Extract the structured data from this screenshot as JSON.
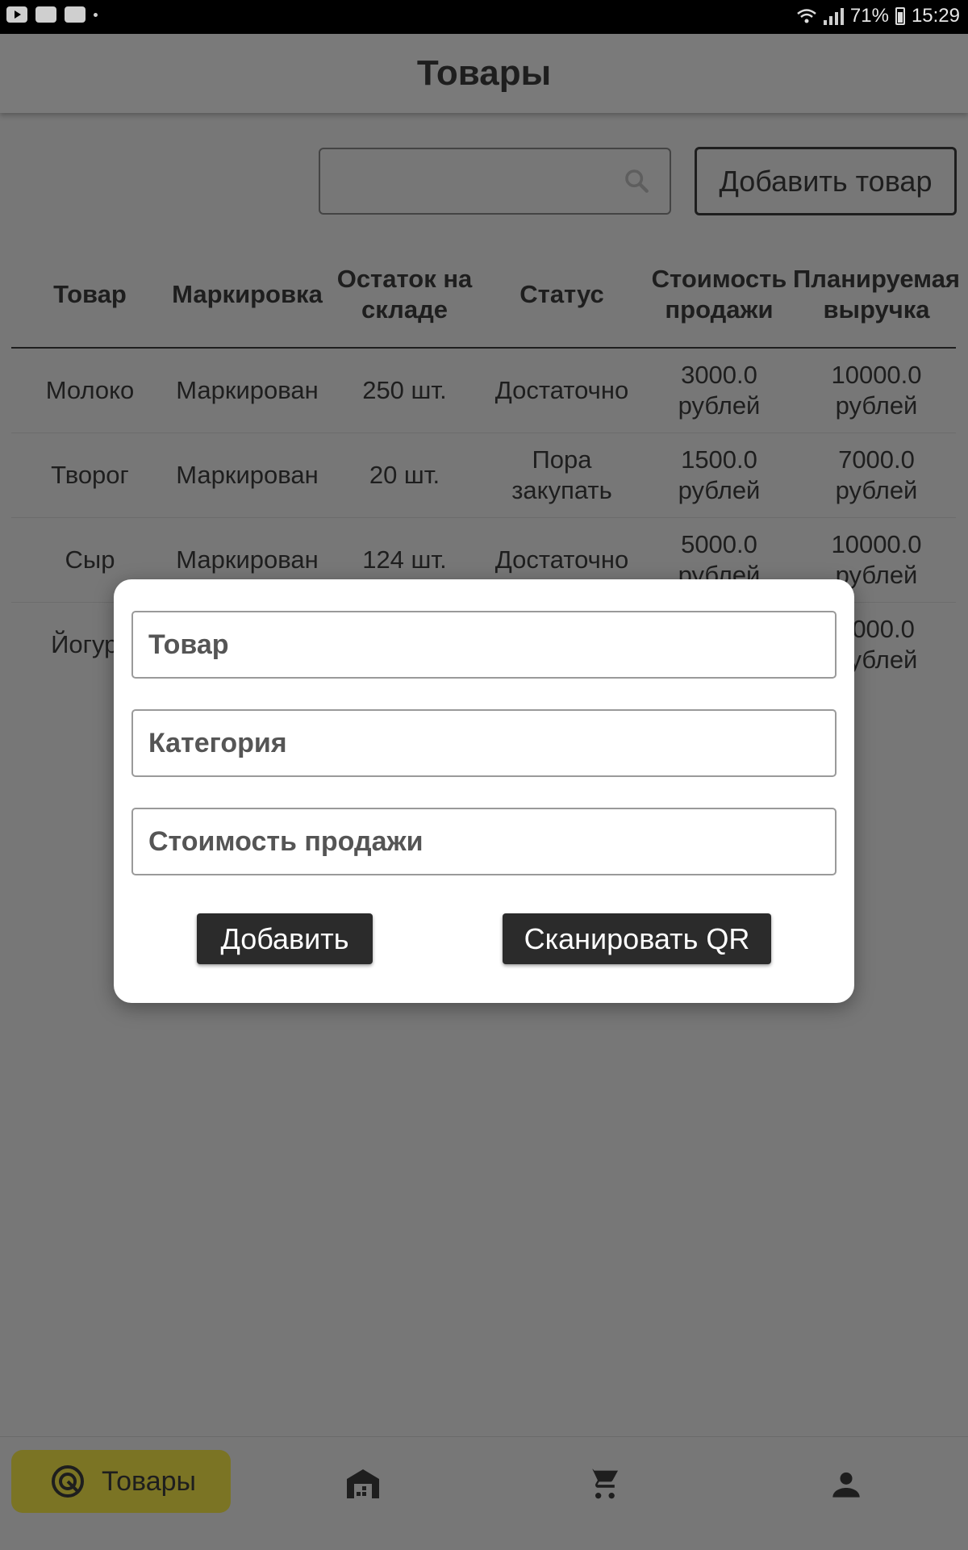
{
  "status_bar": {
    "battery": "71%",
    "time": "15:29"
  },
  "app_bar": {
    "title": "Товары"
  },
  "toolbar": {
    "search_placeholder": "",
    "add_button_label": "Добавить товар"
  },
  "table": {
    "headers": [
      "Товар",
      "Маркировка",
      "Остаток на складе",
      "Статус",
      "Стоимость продажи",
      "Планируемая выручка"
    ],
    "rows": [
      [
        "Молоко",
        "Маркирован",
        "250 шт.",
        "Достаточно",
        "3000.0 рублей",
        "10000.0 рублей"
      ],
      [
        "Творог",
        "Маркирован",
        "20 шт.",
        "Пора закупать",
        "1500.0 рублей",
        "7000.0 рублей"
      ],
      [
        "Сыр",
        "Маркирован",
        "124 шт.",
        "Достаточно",
        "5000.0 рублей",
        "10000.0 рублей"
      ],
      [
        "Йогурт",
        "",
        "",
        "",
        "",
        "5000.0 рублей"
      ]
    ]
  },
  "dialog": {
    "product_placeholder": "Товар",
    "category_placeholder": "Категория",
    "price_placeholder": "Стоимость продажи",
    "add_label": "Добавить",
    "scan_label": "Сканировать QR"
  },
  "bottom_nav": {
    "active_label": "Товары",
    "items": [
      "target-icon",
      "warehouse-icon",
      "cart-icon",
      "person-icon"
    ],
    "active_color": "#7b7424"
  },
  "colors": {
    "overlay": "#777777",
    "dialog_bg": "#ffffff",
    "button_dark": "#2b2b2b"
  }
}
